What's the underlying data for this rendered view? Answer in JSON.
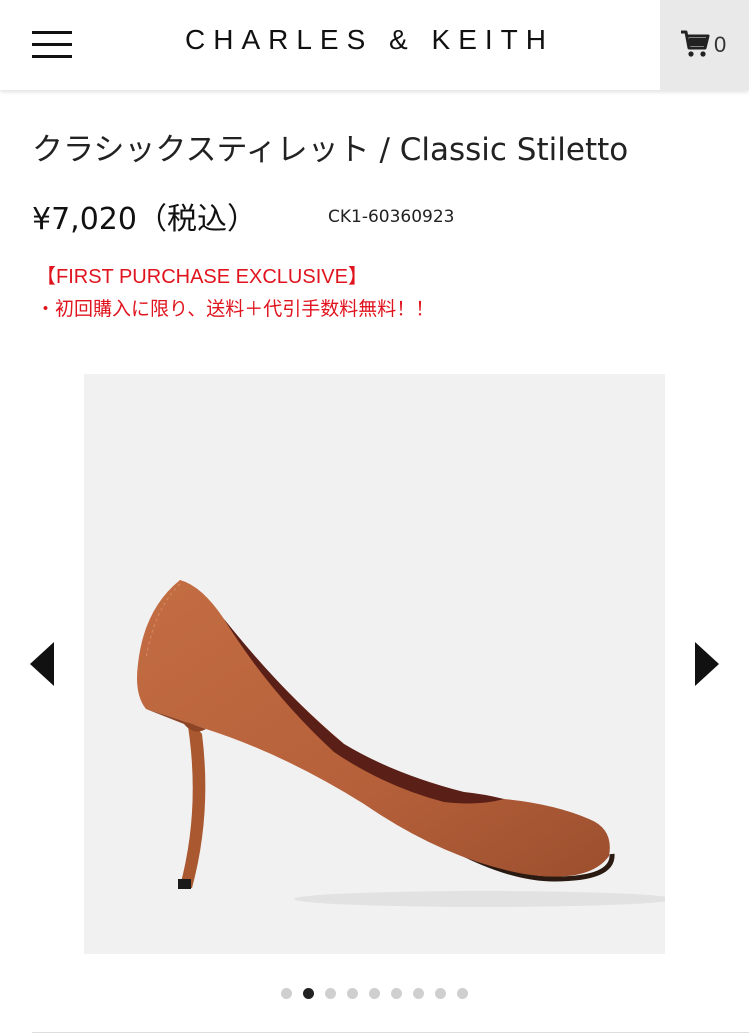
{
  "header": {
    "brand": "CHARLES & KEITH",
    "menu_icon": "hamburger-menu-icon",
    "cart_icon": "shopping-cart-icon",
    "cart_count": "0"
  },
  "product": {
    "title": "クラシックスティレット / Classic Stiletto",
    "price": "¥7,020（税込）",
    "sku": "CK1-60360923",
    "promo_heading": "【FIRST PURCHASE EXCLUSIVE】",
    "promo_text": "・初回購入に限り、送料＋代引手数料無料！！"
  },
  "gallery": {
    "prev_icon": "chevron-left-icon",
    "next_icon": "chevron-right-icon",
    "image_count": 9,
    "active_index": 1
  },
  "colors": {
    "promo": "#e0141e",
    "shoe": "#b8643d",
    "image_bg": "#f1f1f1",
    "cart_bg": "#e9e9e9"
  }
}
